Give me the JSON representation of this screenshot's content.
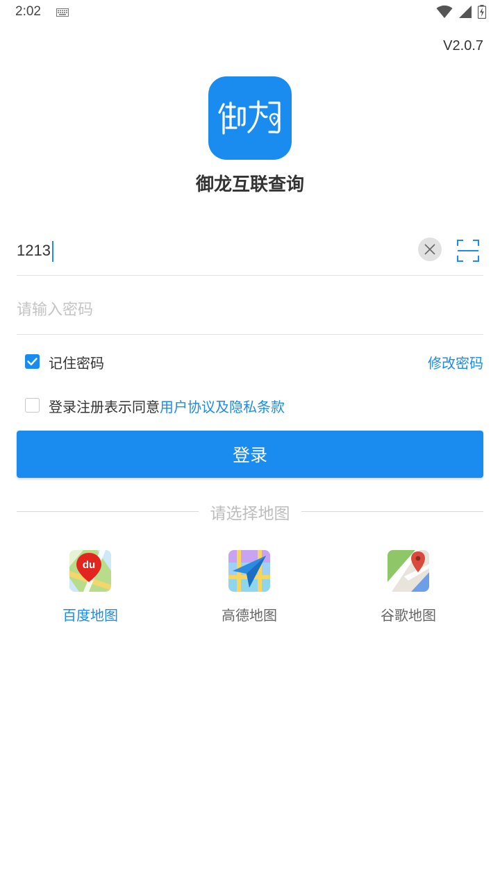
{
  "status_bar": {
    "time": "2:02",
    "icons": [
      "keyboard-icon",
      "wifi-icon",
      "signal-icon",
      "battery-charging-icon"
    ]
  },
  "version": "V2.0.7",
  "app": {
    "name": "御龙互联查询",
    "logo_icon": "yulong-logo",
    "brand_color": "#1a8cf0"
  },
  "login_form": {
    "username_value": "1213",
    "password_placeholder": "请输入密码",
    "remember_label": "记住密码",
    "remember_checked": true,
    "change_password_label": "修改密码",
    "agree_prefix": "登录注册表示同意",
    "agree_link": "用户协议及隐私条款",
    "agree_checked": false,
    "login_button": "登录"
  },
  "map_select": {
    "title": "请选择地图",
    "options": [
      {
        "label": "百度地图",
        "icon": "baidu-map-icon",
        "selected": true
      },
      {
        "label": "高德地图",
        "icon": "amap-icon",
        "selected": false
      },
      {
        "label": "谷歌地图",
        "icon": "google-maps-icon",
        "selected": false
      }
    ]
  }
}
